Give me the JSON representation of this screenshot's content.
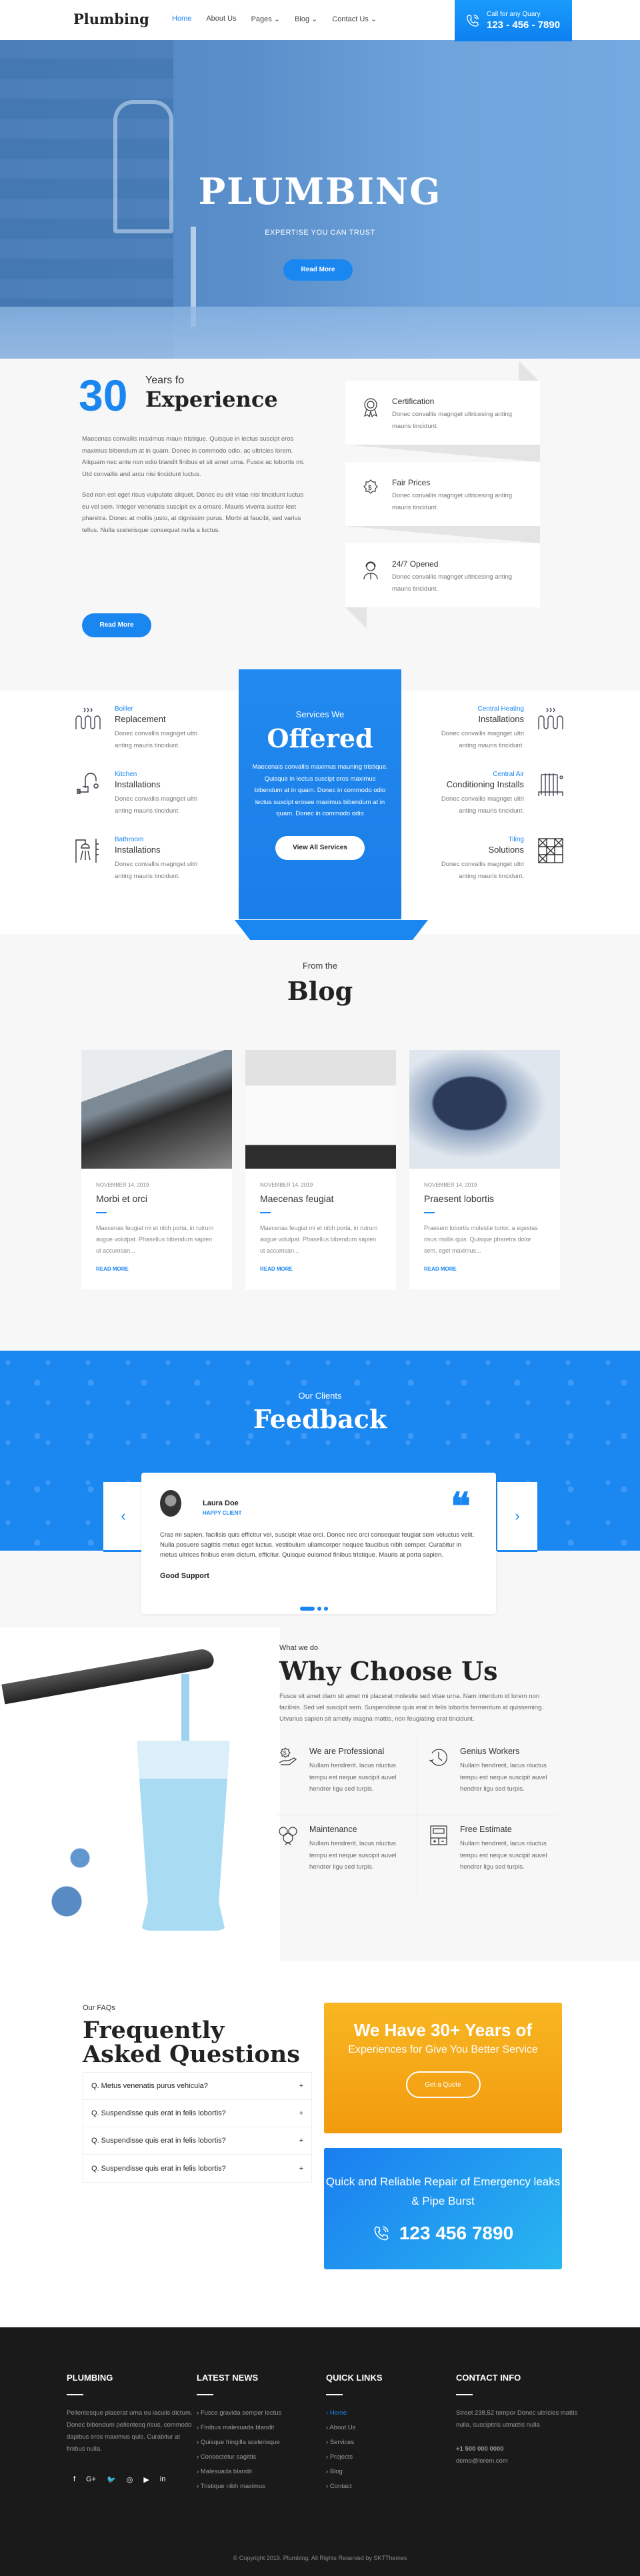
{
  "header": {
    "logo": "Plumbing",
    "nav": [
      {
        "label": "Home",
        "active": true
      },
      {
        "label": "About Us"
      },
      {
        "label": "Pages ⌄"
      },
      {
        "label": "Blog ⌄"
      },
      {
        "label": "Contact Us ⌄"
      }
    ],
    "call_label": "Call for any Quary",
    "call_number": "123 - 456 - 7890"
  },
  "hero": {
    "title": "PLUMBING",
    "subtitle": "EXPERTISE YOU CAN TRUST",
    "button": "Read More"
  },
  "experience": {
    "number": "30",
    "pre": "Years fo",
    "title": "Experience",
    "paragraphs": [
      "Maecenas convallis maximus maun tristique. Quisque in lectus suscipt eros maximus bibendum at in quam. Donec in commodo odio, ac ultricies lorem. Aliquam nec ante non odio blandit finibus et sit amet urna. Fusce ac lobortis mi. Utd convallis and arcu nisi tincidunt luctus.",
      "Sed non est eget risus vulputate aliquet. Donec eu elit vitae nisi tincidunt luctus eu vel sem. Integer venenatis suscipit ex a ornare. Mauris viverra auctor leet pharetra. Donec at mollis justo, at dignissim purus. Morbi at faucibi, sed varius tellus. Nulla scelerisque consequat nulla a luctus."
    ],
    "button": "Read More",
    "features": [
      {
        "icon": "certificate-ribbon-icon",
        "title": "Certification",
        "text": "Donec convallis magnget ultricesing anting mauris tincidunt."
      },
      {
        "icon": "dollar-badge-icon",
        "title": "Fair Prices",
        "text": "Donec convallis magnget ultricesing anting mauris tincidunt."
      },
      {
        "icon": "support-agent-icon",
        "title": "24/7 Opened",
        "text": "Donec convallis magnget ultricesing anting mauris tincidunt."
      }
    ]
  },
  "services": {
    "left": [
      {
        "icon": "boiler-icon",
        "category": "Boiller",
        "title": "Replacement",
        "text": "Donec convallis magnget ultri anting mauris tincidunt."
      },
      {
        "icon": "kitchen-tap-icon",
        "category": "Kitchen",
        "title": "Installations",
        "text": "Donec convallis magnget ultri anting mauris tincidunt."
      },
      {
        "icon": "shower-icon",
        "category": "Bathroom",
        "title": "Installations",
        "text": "Donec convallis magnget ultri anting mauris tincidunt."
      }
    ],
    "right": [
      {
        "icon": "heating-icon",
        "category": "Central Heating",
        "title": "Installations",
        "text": "Donec convallis magnget ultri anting mauris tincidunt."
      },
      {
        "icon": "radiator-icon",
        "category": "Central Air",
        "title": "Conditioning Installs",
        "text": "Donec convallis magnget ultri anting mauris tincidunt."
      },
      {
        "icon": "tiles-icon",
        "category": "Tiling",
        "title": "Solutions",
        "text": "Donec convallis magnget ultri anting mauris tincidunt."
      }
    ],
    "center": {
      "pre": "Services We",
      "title": "Offered",
      "text": "Maecenais convallis maximus mauning tristique. Quisque in lectus suscipt eros maximus bibendum at in quam. Donec in commodo odio lectus suscipt erosee maximus bibendum at in quam. Donec in commodo odio",
      "button": "View All Services"
    }
  },
  "blog": {
    "pre": "From the",
    "title": "Blog",
    "posts": [
      {
        "date": "NOVEMBER 14, 2019",
        "title": "Morbi et orci",
        "excerpt": "Maecenas feugiat mi et nibh porta, in rutrum augue volutpat. Phasellus bibendum sapien ut accumsan...",
        "link": "READ MORE"
      },
      {
        "date": "NOVEMBER 14, 2019",
        "title": "Maecenas feugiat",
        "excerpt": "Maecenas feugiat mi et nibh porta, in rutrum augue volutpat. Phasellus bibendum sapien ut accumsan...",
        "link": "READ MORE"
      },
      {
        "date": "NOVEMBER 14, 2019",
        "title": "Praesent lobortis",
        "excerpt": "Praesent lobortis molestie tortor, a egestas risus mollis quis. Quisque pharetra dolor sem, eget maximus...",
        "link": "READ MORE"
      }
    ]
  },
  "feedback": {
    "pre": "Our Clients",
    "title": "Feedback",
    "name": "Laura Doe",
    "role": "HAPPY CLIENT",
    "quote_mark": "❝",
    "text": "Cras mi sapien, facilisis quis efficitur vel, suscipit vitae orci. Donec nec orci consequat feugiat sem veluctus velit. Nulla posuere sagittis metus eget luctus. vestibulum ullamcorper nequee faucibus nibh semper. Curabitur in metus ultrices finibus enim dictum, efficitur. Quisque euismod finibus tristique. Mauris at porta sapien.",
    "summary": "Good Support",
    "prev": "‹",
    "next": "›",
    "slides": 3,
    "active_slide": 1
  },
  "why": {
    "pre": "What we do",
    "title": "Why Choose Us",
    "lead": "Fusce sit amet diam sit amet mi placerat molestie sed vitae urna. Nam interdum id lorem non facilisis. Sed vel suscipit sem. Suspendisse quis erat in felis lobortis fermentum at quisseming. Utvarius sapien sit ametiy magna mattis, non feugiating erat tincidunt.",
    "items": [
      {
        "icon": "money-hand-icon",
        "title": "We are Professional",
        "text": "Nullam hendrerit, lacus nluctus tempu est neque suscipit auvel hendrer ligu sed turpis."
      },
      {
        "icon": "clock-icon",
        "title": "Genius Workers",
        "text": "Nullam hendrerit, lacus nluctus tempu est neque suscipit auvel hendrer ligu sed turpis."
      },
      {
        "icon": "team-gears-icon",
        "title": "Maintenance",
        "text": "Nullam hendrerit, lacus nluctus tempu est neque suscipit auvel hendrer ligu sed turpis."
      },
      {
        "icon": "calculator-icon",
        "title": "Free Estimate",
        "text": "Nullam hendrerit, lacus nluctus tempu est neque suscipit auvel hendrer ligu sed turpis."
      }
    ]
  },
  "faq": {
    "pre": "Our FAQs",
    "title": "Frequently Asked Questions",
    "items": [
      "Q. Metus venenatis purus vehicula?",
      "Q. Suspendisse quis erat in felis lobortis?",
      "Q. Suspendisse quis erat in felis lobortis?",
      "Q. Suspendisse quis erat in felis lobortis?"
    ],
    "promo": {
      "title": "We Have 30+ Years of",
      "text": "Experiences for Give You Better Service",
      "button": "Get a Quote"
    },
    "emergency": {
      "text": "Quick and Reliable Repair of Emergency leaks & Pipe Burst",
      "phone": "123 456 7890"
    }
  },
  "footer": {
    "about": {
      "title": "PLUMBING",
      "text": "Pellentesque placerat urna eu iaculis dictum. Donec bibendum pellentesq risus, commodo dapibus eros maximus quis. Curabitur at finibus nulla.",
      "social": [
        "f",
        "G+",
        "🐦",
        "◎",
        "▶",
        "in"
      ]
    },
    "news": {
      "title": "LATEST NEWS",
      "items": [
        "Fusce gravida semper lectus",
        "Finibus malesuada blandit",
        "Quisque fringilla scelerisque",
        "Consectetur sagittis",
        "Malesuada blandit",
        "Tristique nibh maximus"
      ]
    },
    "links": {
      "title": "QUICK LINKS",
      "items": [
        "Home",
        "About Us",
        "Services",
        "Projects",
        "Blog",
        "Contact"
      ]
    },
    "contact": {
      "title": "CONTACT INFO",
      "address": "Street 238,52 tempor Donec ultricies mattis nulla, suscipitris utmattis nulla",
      "phone": "+1 500 000 0000",
      "email": "demo@lorem.com"
    },
    "copyright": "© Copyright 2019. Plumbing. All Rights Reserved by SKTThemes"
  },
  "colors": {
    "accent": "#1a86f0",
    "orange": "#f5a816",
    "footer": "#1a1a1a"
  }
}
